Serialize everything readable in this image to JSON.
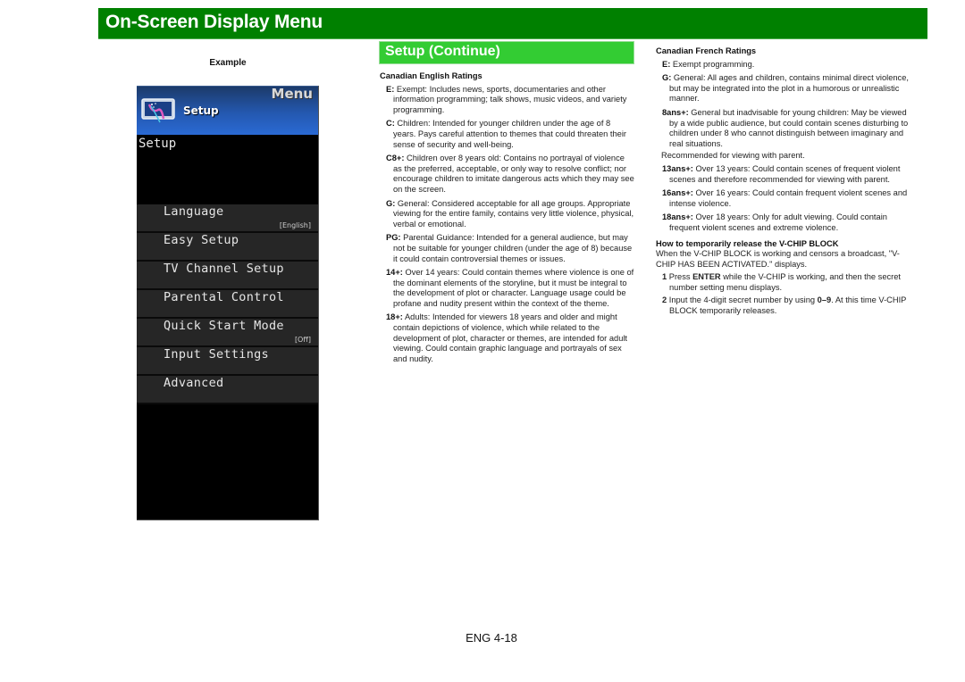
{
  "header": {
    "title": "On-Screen Display Menu"
  },
  "example_label": "Example",
  "tv_menu": {
    "header_menu": "Menu",
    "header_setup": "Setup",
    "section_title": "Setup",
    "items": [
      {
        "label": "Language",
        "value": "[English]"
      },
      {
        "label": "Easy Setup",
        "value": ""
      },
      {
        "label": "TV Channel Setup",
        "value": ""
      },
      {
        "label": "Parental Control",
        "value": ""
      },
      {
        "label": "Quick Start Mode",
        "value": "[Off]"
      },
      {
        "label": "Input Settings",
        "value": ""
      },
      {
        "label": "Advanced",
        "value": ""
      }
    ]
  },
  "section": {
    "title": "Setup (Continue)"
  },
  "english_ratings": {
    "heading": "Canadian English Ratings",
    "entries": [
      {
        "code": "E:",
        "text": " Exempt: Includes news, sports, documentaries and other information programming; talk shows, music videos, and variety programming."
      },
      {
        "code": "C:",
        "text": " Children: Intended for younger children under the age of 8 years. Pays careful attention to themes that could threaten their sense of security and well-being."
      },
      {
        "code": "C8+:",
        "text": " Children over 8 years old: Contains no portrayal of violence as the preferred, acceptable, or only way to resolve conflict; nor encourage children to imitate dangerous acts which they may see on the screen."
      },
      {
        "code": "G:",
        "text": " General: Considered acceptable for all age groups. Appropriate viewing for the entire family, contains very little violence, physical, verbal or emotional."
      },
      {
        "code": "PG:",
        "text": " Parental Guidance: Intended for a general audience, but may not be suitable for younger children (under the age of 8) because it could contain controversial themes or issues."
      },
      {
        "code": "14+:",
        "text": " Over 14 years: Could contain themes where violence is one of the dominant elements of the storyline, but it must be integral to the development of plot or character. Language usage could be profane and nudity present within the context of the theme."
      },
      {
        "code": "18+:",
        "text": " Adults: Intended for viewers 18 years and older and might contain depictions of violence, which while related to the development of plot, character or themes, are intended for adult viewing. Could contain graphic language and portrayals of sex and nudity."
      }
    ]
  },
  "french_ratings": {
    "heading": "Canadian French Ratings",
    "entries": [
      {
        "code": "E:",
        "text": " Exempt programming."
      },
      {
        "code": "G:",
        "text": " General: All ages and children, contains minimal direct violence, but may be integrated into the plot in a humorous or unrealistic manner."
      },
      {
        "code": "8ans+:",
        "text": " General but inadvisable for young children: May be viewed by a wide public audience, but could contain scenes disturbing to children under 8 who cannot distinguish between imaginary and real situations."
      }
    ],
    "note": "Recommended for viewing with parent.",
    "entries2": [
      {
        "code": "13ans+:",
        "text": " Over 13 years: Could contain scenes of frequent violent scenes and therefore recommended for viewing with parent."
      },
      {
        "code": "16ans+:",
        "text": " Over 16 years: Could contain frequent violent scenes and intense violence."
      },
      {
        "code": "18ans+:",
        "text": " Over 18 years: Only for adult viewing. Could contain frequent violent scenes and extreme violence."
      }
    ]
  },
  "vchip": {
    "heading": "How to temporarily release the V-CHIP BLOCK",
    "intro": "When the V-CHIP BLOCK is working and censors a broadcast, \"V-CHIP HAS BEEN ACTIVATED.\" displays.",
    "steps": [
      {
        "num": "1",
        "pre": " Press ",
        "bold": "ENTER",
        "post": " while the V-CHIP is working, and then the secret number setting menu displays."
      },
      {
        "num": "2",
        "pre": " Input the 4-digit secret number by using ",
        "bold": "0–9",
        "post": ". At this time V-CHIP BLOCK temporarily releases."
      }
    ]
  },
  "page_number": "ENG 4-18"
}
